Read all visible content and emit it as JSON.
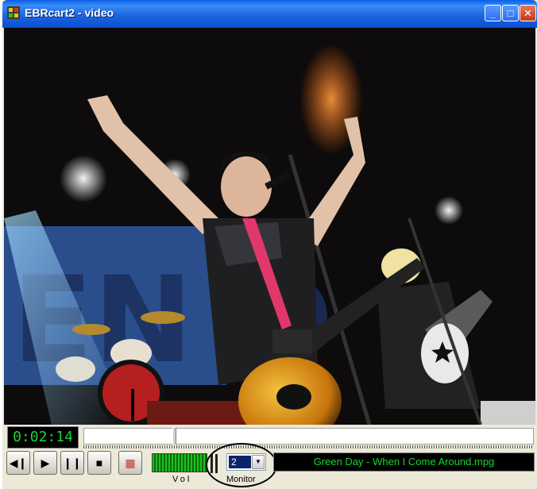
{
  "window": {
    "title": "EBRcart2 - video",
    "buttons": {
      "minimize": "_",
      "maximize": "□",
      "close": "✕"
    }
  },
  "video": {
    "description_icon": "video-frame-image"
  },
  "timebar": {
    "elapsed": "0:02:14",
    "seek_position": 0.2
  },
  "controls": {
    "buttons": [
      {
        "name": "previous-button",
        "icon": "skip-back-icon",
        "glyph": "◀❙"
      },
      {
        "name": "play-button",
        "icon": "play-icon",
        "glyph": "▶"
      },
      {
        "name": "pause-button",
        "icon": "pause-icon",
        "glyph": "❙❙"
      },
      {
        "name": "stop-button",
        "icon": "stop-icon",
        "glyph": "■"
      },
      {
        "name": "color-button",
        "icon": "color-palette-icon",
        "glyph": "▦"
      }
    ],
    "volume_label": "Vol",
    "volume_level": 1.0,
    "monitor_label": "Monitor",
    "monitor_value": "2",
    "track_title": "Green Day - When I Come Around.mpg"
  },
  "colors": {
    "title_bar": "#1b66e0",
    "lcd_text": "#19d432",
    "lcd_bg": "#000000",
    "window_bg": "#ece9d8"
  }
}
